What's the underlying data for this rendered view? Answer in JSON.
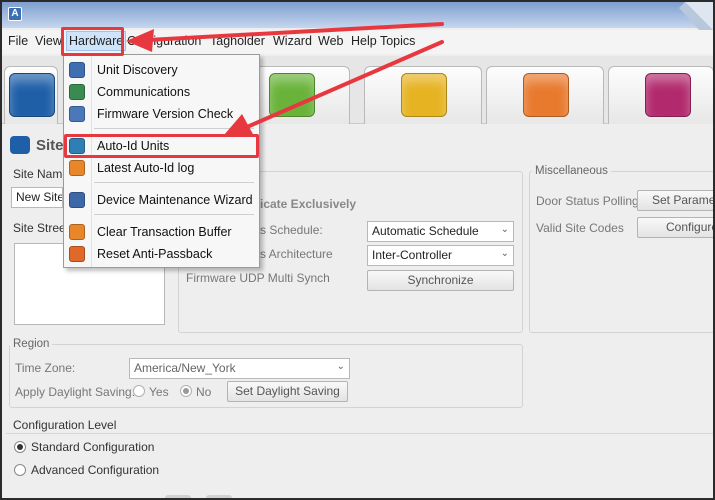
{
  "menu": {
    "items": [
      "File",
      "View",
      "Hardware",
      "Configuration",
      "Tagholder",
      "Wizard",
      "Web",
      "Help Topics"
    ]
  },
  "hardware_menu": {
    "items": [
      {
        "label": "Unit Discovery",
        "icon": "unit-discovery-icon",
        "color": "#3f6fb0"
      },
      {
        "label": "Communications",
        "icon": "communications-icon",
        "color": "#3a8a52"
      },
      {
        "label": "Firmware Version Check",
        "icon": "firmware-icon",
        "color": "#4a78b8"
      },
      {
        "label": "Auto-Id Units",
        "icon": "auto-id-icon",
        "color": "#2f7fb5"
      },
      {
        "label": "Latest Auto-Id log",
        "icon": "log-icon",
        "color": "#e8862a"
      },
      {
        "label": "Device Maintenance Wizard",
        "icon": "maintenance-icon",
        "color": "#3d68a8"
      },
      {
        "label": "Clear Transaction Buffer",
        "icon": "clear-buffer-icon",
        "color": "#e8862a"
      },
      {
        "label": "Reset Anti-Passback",
        "icon": "reset-antipassback-icon",
        "color": "#e0692a"
      }
    ]
  },
  "tabs": [
    {
      "icon": "site-icon",
      "color": "#1f5fa8"
    },
    {
      "icon": "hardware-icon",
      "color": "#69b33a"
    },
    {
      "icon": "tagholders-icon",
      "color": "#e6b322"
    },
    {
      "icon": "users-icon",
      "color": "#e87a2e"
    },
    {
      "icon": "home-icon",
      "color": "#b22a6d"
    }
  ],
  "site": {
    "header": "Site",
    "site_name_label": "Site Name",
    "site_name_value": "New Site",
    "site_street_label": "Site Street"
  },
  "middle": {
    "subheading": "icate Exclusively",
    "schedule_label": "s Schedule:",
    "schedule_value": "Automatic Schedule",
    "architecture_label": "s Architecture",
    "architecture_value": "Inter-Controller",
    "udp_label": "Firmware UDP Multi Synch",
    "synchronize": "Synchronize"
  },
  "misc": {
    "title": "Miscellaneous",
    "door_status_label": "Door Status Polling:",
    "set_parameters": "Set Paramete",
    "valid_codes_label": "Valid Site Codes",
    "configure": "Configure"
  },
  "region": {
    "title": "Region",
    "timezone_label": "Time Zone:",
    "timezone_value": "America/New_York",
    "daylight_label": "Apply Daylight Saving:",
    "yes": "Yes",
    "no": "No",
    "set_daylight": "Set Daylight Saving"
  },
  "config_level": {
    "title": "Configuration Level",
    "standard": "Standard Configuration",
    "advanced": "Advanced Configuration"
  },
  "colors": {
    "highlight": "#e8383f"
  }
}
